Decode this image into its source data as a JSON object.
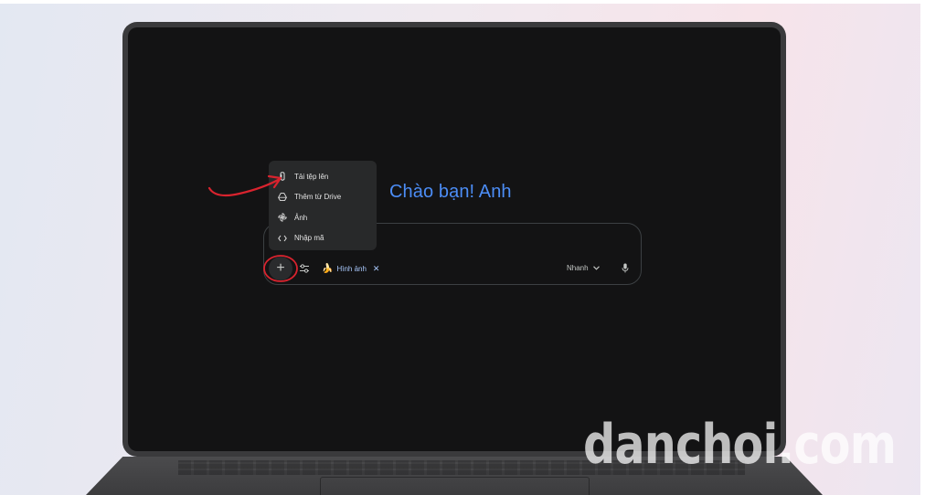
{
  "greeting": "Chào bạn! Anh",
  "upload_menu": {
    "items": [
      {
        "label": "Tải tệp lên",
        "icon": "paperclip-icon"
      },
      {
        "label": "Thêm từ Drive",
        "icon": "drive-icon"
      },
      {
        "label": "Ảnh",
        "icon": "photos-icon"
      },
      {
        "label": "Nhập mã",
        "icon": "code-icon"
      }
    ]
  },
  "prompt_bar": {
    "plus_label": "+",
    "tool_chip": {
      "label": "Hình ảnh",
      "emoji": "🍌",
      "close": "✕"
    },
    "mode": {
      "label": "Nhanh",
      "chevron": "⌄"
    }
  },
  "watermark": "danchoi.com",
  "colors": {
    "background": "#131314",
    "greeting_blue": "#4c8df6",
    "chip_blue": "#a8c7fa",
    "annotation_red": "#d9232e"
  }
}
